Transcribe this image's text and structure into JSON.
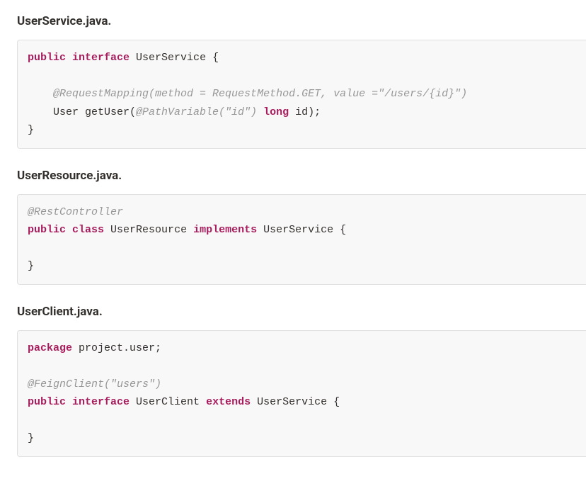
{
  "sections": [
    {
      "title": "UserService.java.",
      "code": {
        "tokens": [
          {
            "k": "kw",
            "t": "public"
          },
          {
            "k": "plain",
            "t": " "
          },
          {
            "k": "kw",
            "t": "interface"
          },
          {
            "k": "plain",
            "t": " UserService {\n\n    "
          },
          {
            "k": "anno",
            "t": "@RequestMapping(method = RequestMethod.GET, value =\"/users/{id}\")"
          },
          {
            "k": "plain",
            "t": "\n    User getUser("
          },
          {
            "k": "anno",
            "t": "@PathVariable(\"id\")"
          },
          {
            "k": "plain",
            "t": " "
          },
          {
            "k": "kw",
            "t": "long"
          },
          {
            "k": "plain",
            "t": " id);\n}"
          }
        ]
      }
    },
    {
      "title": "UserResource.java.",
      "code": {
        "tokens": [
          {
            "k": "anno",
            "t": "@RestController"
          },
          {
            "k": "plain",
            "t": "\n"
          },
          {
            "k": "kw",
            "t": "public"
          },
          {
            "k": "plain",
            "t": " "
          },
          {
            "k": "kw",
            "t": "class"
          },
          {
            "k": "plain",
            "t": " UserResource "
          },
          {
            "k": "kw",
            "t": "implements"
          },
          {
            "k": "plain",
            "t": " UserService {\n\n}"
          }
        ]
      }
    },
    {
      "title": "UserClient.java.",
      "code": {
        "tokens": [
          {
            "k": "kw",
            "t": "package"
          },
          {
            "k": "plain",
            "t": " project.user;\n\n"
          },
          {
            "k": "anno",
            "t": "@FeignClient(\"users\")"
          },
          {
            "k": "plain",
            "t": "\n"
          },
          {
            "k": "kw",
            "t": "public"
          },
          {
            "k": "plain",
            "t": " "
          },
          {
            "k": "kw",
            "t": "interface"
          },
          {
            "k": "plain",
            "t": " UserClient "
          },
          {
            "k": "kw",
            "t": "extends"
          },
          {
            "k": "plain",
            "t": " UserService {\n\n}"
          }
        ]
      }
    }
  ]
}
